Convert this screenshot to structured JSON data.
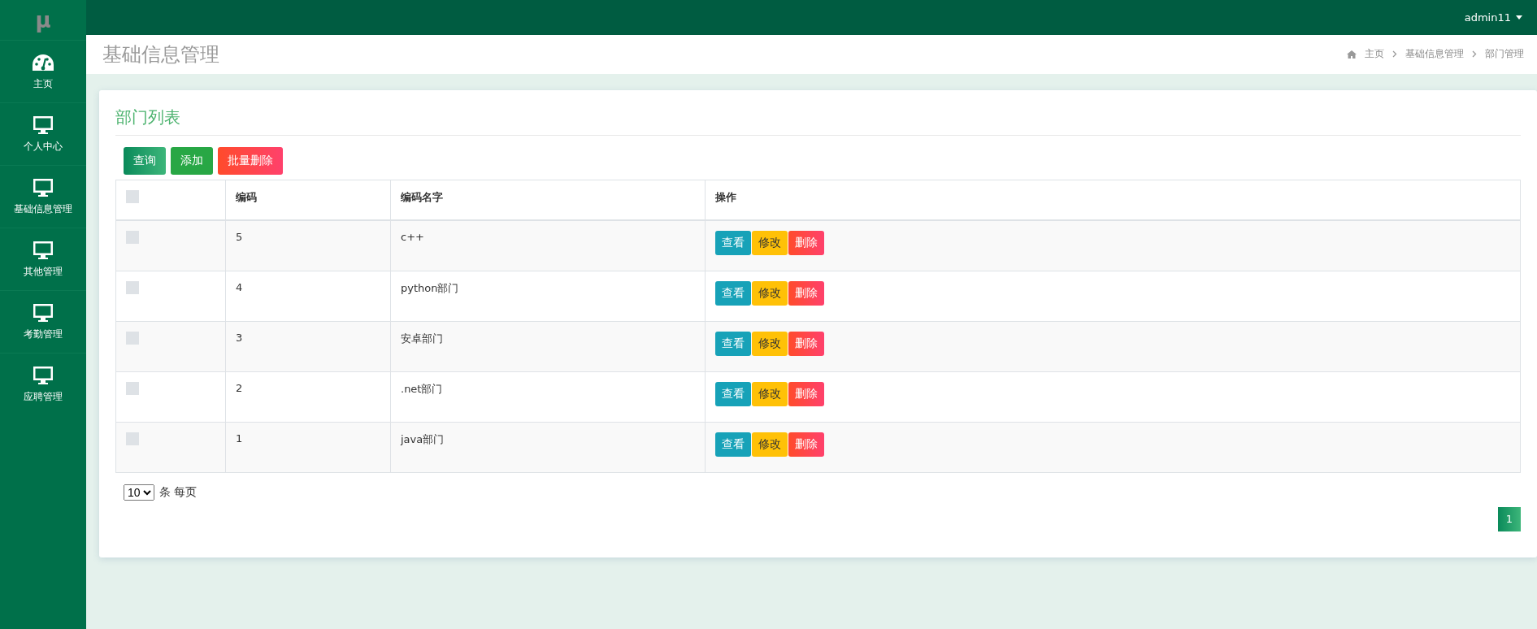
{
  "logo": "μ",
  "user": {
    "name": "admin11"
  },
  "sidebar": {
    "items": [
      {
        "label": "主页",
        "kind": "gauge"
      },
      {
        "label": "个人中心",
        "kind": "monitor"
      },
      {
        "label": "基础信息管理",
        "kind": "monitor"
      },
      {
        "label": "其他管理",
        "kind": "monitor"
      },
      {
        "label": "考勤管理",
        "kind": "monitor"
      },
      {
        "label": "应聘管理",
        "kind": "monitor"
      }
    ]
  },
  "page_title": "基础信息管理",
  "breadcrumb": [
    "主页",
    "基础信息管理",
    "部门管理"
  ],
  "card": {
    "title": "部门列表",
    "toolbar": [
      {
        "label": "查询",
        "kind": "search"
      },
      {
        "label": "添加",
        "kind": "add"
      },
      {
        "label": "批量删除",
        "kind": "delete"
      }
    ],
    "table": {
      "header_checked": false,
      "columns": [
        "编码",
        "编码名字",
        "操作"
      ],
      "rows": [
        {
          "checked": false,
          "code": "5",
          "name": "c++",
          "actions": [
            "查看",
            "修改",
            "删除"
          ]
        },
        {
          "checked": false,
          "code": "4",
          "name": "python部门",
          "actions": [
            "查看",
            "修改",
            "删除"
          ]
        },
        {
          "checked": false,
          "code": "3",
          "name": "安卓部门",
          "actions": [
            "查看",
            "修改",
            "删除"
          ]
        },
        {
          "checked": false,
          "code": "2",
          "name": ".net部门",
          "actions": [
            "查看",
            "修改",
            "删除"
          ]
        },
        {
          "checked": false,
          "code": "1",
          "name": "java部门",
          "actions": [
            "查看",
            "修改",
            "删除"
          ]
        }
      ]
    },
    "page_size": {
      "value": "10",
      "label": "条 每页"
    },
    "pages": [
      {
        "label": "1",
        "selected": true
      }
    ]
  }
}
